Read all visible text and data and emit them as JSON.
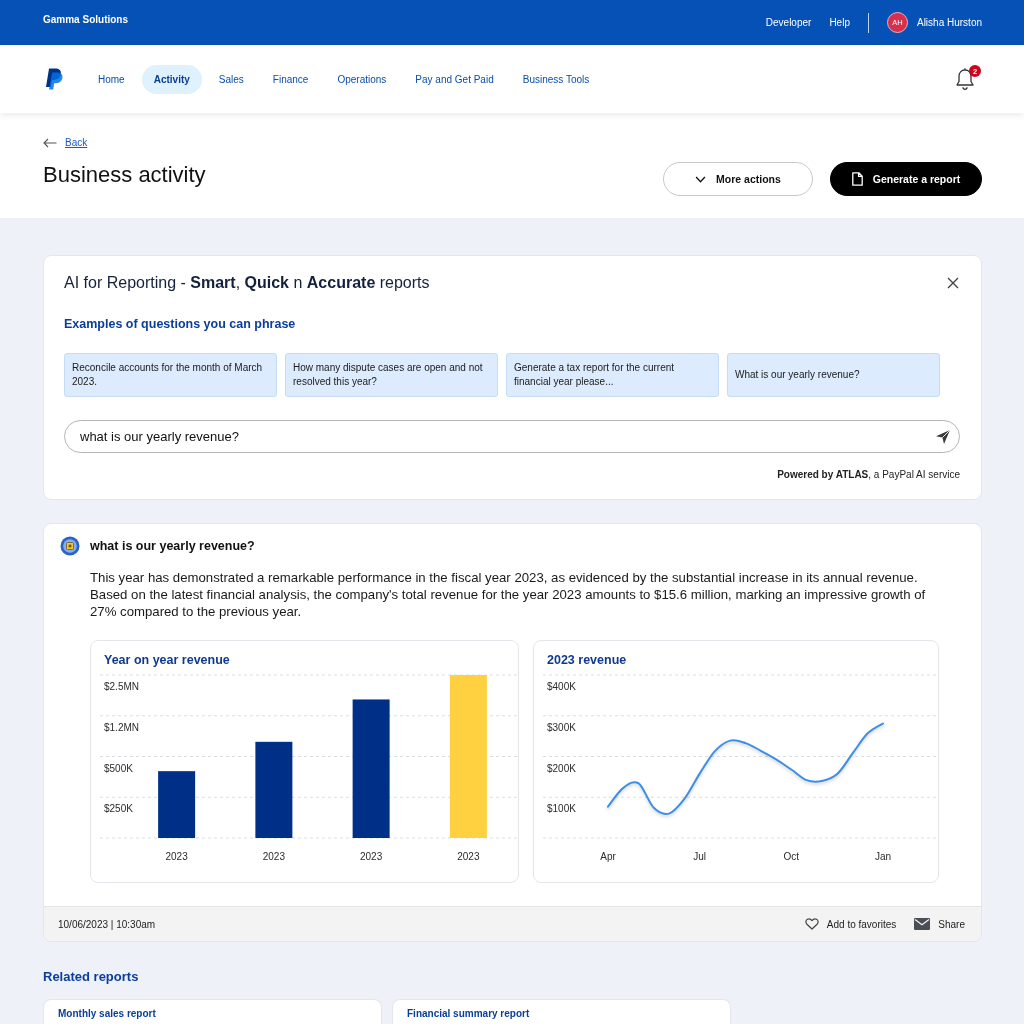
{
  "top_bar": {
    "company": "Gamma Solutions",
    "links": [
      "Developer",
      "Help"
    ],
    "user": {
      "initials": "AH",
      "name": "Alisha Hurston"
    }
  },
  "nav": {
    "items": [
      {
        "label": "Home",
        "selected": false
      },
      {
        "label": "Activity",
        "selected": true
      },
      {
        "label": "Sales",
        "selected": false
      },
      {
        "label": "Finance",
        "selected": false
      },
      {
        "label": "Operations",
        "selected": false
      },
      {
        "label": "Pay and Get Paid",
        "selected": false
      },
      {
        "label": "Business Tools",
        "selected": false
      }
    ],
    "notifications": "2"
  },
  "page_header": {
    "back": "Back",
    "title": "Business activity",
    "buttons": [
      {
        "label": "More actions",
        "kind": "dropdown"
      },
      {
        "label": "Generate a report",
        "kind": "primary"
      }
    ]
  },
  "ai_panel": {
    "title": "AI for Reporting - **Smart**, **Quick** n **Accurate** reports",
    "examples_heading": "Examples of questions you can phrase",
    "examples": [
      "Reconcile accounts for the month of March 2023.",
      "How many dispute cases are open and not resolved this year?",
      "Generate a tax report for the current financial year please...",
      "What is our yearly revenue?"
    ],
    "query": {
      "value": "what is our yearly revenue?"
    },
    "powered_by": "**Powered by ATLAS**, a PayPal AI service"
  },
  "response": {
    "question": "what is our yearly revenue?",
    "answer": "This year has demonstrated a remarkable performance in the fiscal year 2023, as evidenced by the substantial increase in its annual revenue. Based on the latest financial analysis, the company's total revenue for the year 2023 amounts to $15.6 million, marking an impressive growth of 27% compared to the previous year.",
    "charts": [
      {
        "title": "Year on year revenue",
        "y_axis_labels": [
          "$2.5MN",
          "$1.2MN",
          "$500K",
          "$250K"
        ],
        "bars": [
          {
            "label": "2023",
            "color": "#002f87"
          },
          {
            "label": "2023",
            "color": "#002f87"
          },
          {
            "label": "2023",
            "color": "#002f87"
          },
          {
            "label": "2023",
            "color": "#ffd140"
          }
        ]
      },
      {
        "chart_data": {
          "type": "line",
          "title": "2023 revenue",
          "categories": [
            "Apr",
            null,
            null,
            null,
            null,
            null,
            "Jul",
            null,
            null,
            null,
            null,
            null,
            "Oct",
            null,
            null,
            null,
            null,
            null,
            "Jan"
          ],
          "series": [
            {
              "color": "#3d8ee6",
              "values": [
                77,
                123,
                134,
                74,
                60,
                96,
                158,
                213,
                239,
                233,
                214,
                193,
                168,
                142,
                140,
                157,
                207,
                257,
                281
              ]
            }
          ],
          "ylim": [
            0,
            400
          ],
          "yticks": [
            {
              "value": 100,
              "label": "$100K"
            },
            {
              "value": 200,
              "label": "$200K"
            },
            {
              "value": 300,
              "label": "$300K"
            },
            {
              "value": 400,
              "label": "$400K"
            }
          ],
          "grid": true
        }
      }
    ],
    "timestamp": "10/06/2023 | 10:30am",
    "actions": [
      {
        "label": "Add to favorites",
        "kind": "favorite"
      },
      {
        "label": "Share",
        "kind": "share"
      }
    ]
  },
  "related_reports": {
    "heading": "Related reports",
    "items": [
      "Monthly sales report",
      "Financial summary report"
    ]
  }
}
